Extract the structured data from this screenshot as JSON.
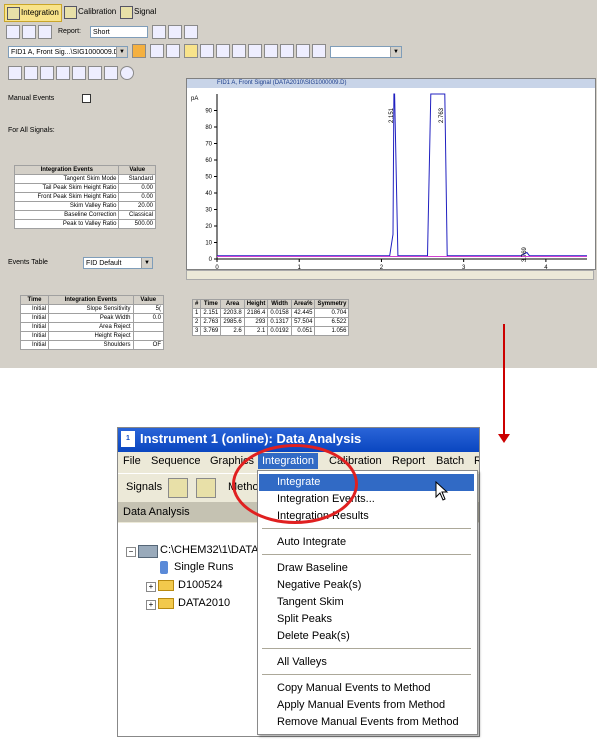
{
  "top": {
    "tabs": [
      "Integration",
      "Calibration",
      "Signal"
    ],
    "report_label": "Report:",
    "report_value": "Short",
    "signal_select": "FID1 A, Front Sig...\\SIG1000009.D)",
    "manual_events_label": "Manual Events",
    "for_all_signals_label": "For All Signals:",
    "integration_events": {
      "headers": [
        "Integration Events",
        "Value"
      ],
      "rows": [
        [
          "Tangent Skim Mode",
          "Standard"
        ],
        [
          "Tail Peak Skim Height Ratio",
          "0.00"
        ],
        [
          "Front Peak Skim Height Ratio",
          "0.00"
        ],
        [
          "Skim Valley Ratio",
          "20.00"
        ],
        [
          "Baseline Correction",
          "Classical"
        ],
        [
          "Peak to Valley Ratio",
          "500.00"
        ]
      ]
    },
    "events_table_label": "Events Table",
    "events_table_value": "FID Default",
    "timed_events": {
      "headers": [
        "Time",
        "Integration Events",
        "Value"
      ],
      "rows": [
        [
          "Initial",
          "Slope Sensitivity",
          "5("
        ],
        [
          "Initial",
          "Peak Width",
          "0.0"
        ],
        [
          "Initial",
          "Area Reject",
          ""
        ],
        [
          "Initial",
          "Height Reject",
          ""
        ],
        [
          "Initial",
          "Shoulders",
          "OF"
        ]
      ]
    },
    "chart_title": "FID1 A, Front Signal (DATA2010\\SIG1000009.D)",
    "peaks_table": {
      "headers": [
        "#",
        "Time",
        "Area",
        "Height",
        "Width",
        "Area%",
        "Symmetry"
      ],
      "rows": [
        [
          "1",
          "2.151",
          "2203.8",
          "2186.4",
          "0.0158",
          "42.445",
          "0.704"
        ],
        [
          "2",
          "2.763",
          "2985.6",
          "293",
          "0.1317",
          "57.504",
          "6.522"
        ],
        [
          "3",
          "3.769",
          "2.6",
          "2.1",
          "0.0192",
          "0.051",
          "1.056"
        ]
      ]
    }
  },
  "chart_data": {
    "type": "line",
    "title": "FID1 A, Front Signal (DATA2010\\SIG1000009.D)",
    "ylabel": "pA",
    "xlim": [
      0,
      4.5
    ],
    "ylim": [
      0,
      100
    ],
    "xticks": [
      0,
      1,
      2,
      3,
      4
    ],
    "yticks": [
      0,
      10,
      20,
      30,
      40,
      50,
      60,
      70,
      80,
      90
    ],
    "peak_labels": [
      "2.151",
      "2.763",
      "3.769"
    ],
    "series": [
      {
        "color": "#2020c0",
        "x": [
          0,
          2.1,
          2.14,
          2.151,
          2.16,
          2.2,
          2.56,
          2.6,
          2.62,
          2.7,
          2.763,
          2.77,
          2.8,
          3.7,
          3.769,
          3.8,
          4.5
        ],
        "y": [
          2,
          2,
          15,
          100,
          100,
          2,
          2,
          100,
          100,
          100,
          100,
          100,
          2,
          2,
          4,
          2,
          2
        ]
      },
      {
        "color": "#d040d0",
        "x": [
          0,
          4.5
        ],
        "y": [
          1.5,
          1.5
        ]
      }
    ]
  },
  "window": {
    "title": "Instrument 1 (online): Data Analysis",
    "menus": [
      "File",
      "Sequence",
      "Graphics",
      "Integration",
      "Calibration",
      "Report",
      "Batch",
      "R"
    ],
    "toolbar": {
      "signals_label": "Signals",
      "method_label": "Metho"
    },
    "panel_header": "Data Analysis",
    "tree": {
      "root": "C:\\CHEM32\\1\\DATA",
      "items": [
        "Single Runs",
        "D100524",
        "DATA2010"
      ]
    },
    "integration_menu": [
      "Integrate",
      "Integration Events...",
      "Integration Results",
      "Auto Integrate",
      "Draw Baseline",
      "Negative Peak(s)",
      "Tangent Skim",
      "Split Peaks",
      "Delete Peak(s)",
      "All Valleys",
      "Copy Manual Events to Method",
      "Apply Manual Events from Method",
      "Remove Manual Events from Method"
    ]
  },
  "colors": {
    "highlight": "#316ac5",
    "annotation": "#e02020",
    "arrow": "#cc0000"
  }
}
